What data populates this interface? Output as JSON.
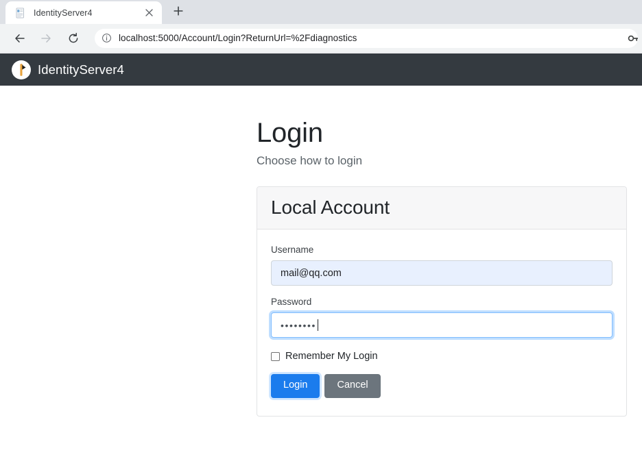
{
  "browser": {
    "tab": {
      "title": "IdentityServer4",
      "favicon_icon": "page-favicon-icon",
      "close_icon": "close-icon"
    },
    "new_tab_icon": "plus-icon",
    "nav": {
      "back_icon": "back-arrow-icon",
      "forward_icon": "forward-arrow-icon",
      "reload_icon": "reload-icon"
    },
    "omnibox": {
      "info_icon": "info-circle-icon",
      "url": "localhost:5000/Account/Login?ReturnUrl=%2Fdiagnostics",
      "key_icon": "key-icon"
    },
    "colors": {
      "tabstrip_bg": "#dee1e6",
      "toolbar_bg": "#f1f3f4",
      "tab_active_bg": "#ffffff"
    }
  },
  "site": {
    "navbar": {
      "brand": "IdentityServer4",
      "logo_icon": "identityserver-logo-icon",
      "bg_color": "#343a40"
    },
    "heading": {
      "title": "Login",
      "subtitle": "Choose how to login"
    },
    "card": {
      "header_title": "Local Account",
      "fields": [
        {
          "name": "username",
          "label": "Username",
          "value": "mail@qq.com",
          "placeholder": "Username",
          "state": "autofilled"
        },
        {
          "name": "password",
          "label": "Password",
          "value": "••••••••",
          "placeholder": "Password",
          "state": "focused"
        }
      ],
      "remember": {
        "label": "Remember My Login",
        "checked": false
      },
      "buttons": {
        "login": "Login",
        "cancel": "Cancel"
      },
      "colors": {
        "header_bg": "#f7f7f8",
        "border": "#e2e3e5",
        "primary": "#1b7ced",
        "secondary": "#6c757d",
        "autofill_bg": "#e8f0fe",
        "focus_border": "#80bdff"
      }
    }
  }
}
